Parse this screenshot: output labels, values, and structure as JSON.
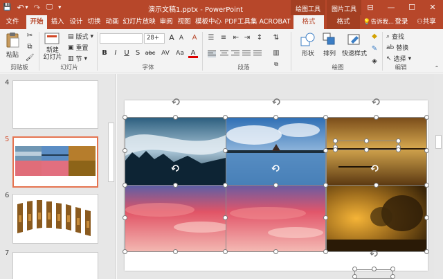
{
  "titlebar": {
    "qat": {
      "save": "💾",
      "undo": "↶",
      "undo_dropdown": "▾",
      "redo": "↷",
      "present": "🖵",
      "customize": "▾"
    },
    "title": "演示文稿1.pptx - PowerPoint",
    "context_draw_label": "绘图工具",
    "context_picture_label": "图片工具",
    "controls": {
      "ribbon_display": "⊟",
      "minimize": "—",
      "maximize": "☐",
      "close": "✕"
    }
  },
  "tabs": [
    "文件",
    "开始",
    "插入",
    "设计",
    "切换",
    "动画",
    "幻灯片放映",
    "审阅",
    "视图",
    "模板中心",
    "PDF工具集",
    "ACROBAT",
    "格式",
    "格式"
  ],
  "tab_right": {
    "tell_me": "告诉我...",
    "login": "登录",
    "share": "共享"
  },
  "ribbon": {
    "clipboard": {
      "paste": "粘贴",
      "label": "剪贴板"
    },
    "slides": {
      "new_slide": "新建\n幻灯片",
      "layout": "版式",
      "reset": "重置",
      "section": "节",
      "label": "幻灯片"
    },
    "font": {
      "name_value": "",
      "size_value": "28+",
      "grow": "A",
      "shrink": "A",
      "clear": "A",
      "bold": "B",
      "italic": "I",
      "underline": "U",
      "strike": "S",
      "abc": "abc",
      "spacing": "AV",
      "case": "Aa",
      "color": "A",
      "label": "字体"
    },
    "paragraph": {
      "label": "段落"
    },
    "drawing": {
      "shapes": "形状",
      "arrange": "排列",
      "quick_styles": "快速样式",
      "label": "绘图"
    },
    "editing": {
      "find": "查找",
      "replace": "替换",
      "select": "选择",
      "label": "编辑"
    }
  },
  "thumbnails": [
    {
      "number": "4"
    },
    {
      "number": "5"
    },
    {
      "number": "6"
    },
    {
      "number": "7"
    }
  ],
  "colors": {
    "accent": "#b7472a",
    "selected_thumb": "#e5734f"
  }
}
